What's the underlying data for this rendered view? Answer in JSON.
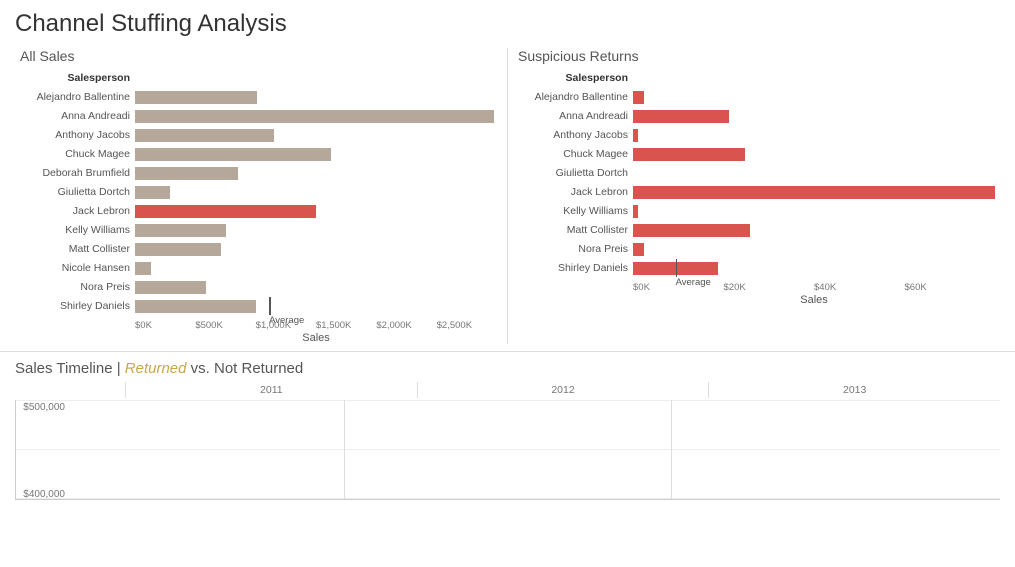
{
  "page": {
    "title": "Channel Stuffing Analysis"
  },
  "all_sales": {
    "title": "All Sales",
    "axis_label": "Sales",
    "header": "Salesperson",
    "avg_label": "Average",
    "x_ticks": [
      "$0K",
      "$500K",
      "$1,000K",
      "$1,500K",
      "$2,000K",
      "$2,500K"
    ],
    "max_value": 2700,
    "avg_value": 1000,
    "bars": [
      {
        "label": "Alejandro Ballentine",
        "value": 910,
        "type": "tan"
      },
      {
        "label": "Anna Andreadi",
        "value": 2680,
        "type": "tan"
      },
      {
        "label": "Anthony Jacobs",
        "value": 1040,
        "type": "tan"
      },
      {
        "label": "Chuck Magee",
        "value": 1460,
        "type": "tan"
      },
      {
        "label": "Deborah Brumfield",
        "value": 770,
        "type": "tan"
      },
      {
        "label": "Giulietta Dortch",
        "value": 260,
        "type": "tan"
      },
      {
        "label": "Jack Lebron",
        "value": 1350,
        "type": "red"
      },
      {
        "label": "Kelly Williams",
        "value": 680,
        "type": "tan"
      },
      {
        "label": "Matt Collister",
        "value": 640,
        "type": "tan"
      },
      {
        "label": "Nicole Hansen",
        "value": 120,
        "type": "tan"
      },
      {
        "label": "Nora Preis",
        "value": 530,
        "type": "tan"
      },
      {
        "label": "Shirley Daniels",
        "value": 900,
        "type": "tan"
      }
    ]
  },
  "suspicious_returns": {
    "title": "Suspicious Returns",
    "axis_label": "Sales",
    "header": "Salesperson",
    "avg_label": "Average",
    "x_ticks": [
      "$0K",
      "$20K",
      "$40K",
      "$60K"
    ],
    "max_value": 68,
    "avg_value": 8,
    "bars": [
      {
        "label": "Alejandro Ballentine",
        "value": 2,
        "type": "red"
      },
      {
        "label": "Anna Andreadi",
        "value": 18,
        "type": "red"
      },
      {
        "label": "Anthony Jacobs",
        "value": 1,
        "type": "red"
      },
      {
        "label": "Chuck Magee",
        "value": 21,
        "type": "red"
      },
      {
        "label": "Giulietta Dortch",
        "value": 0,
        "type": "red"
      },
      {
        "label": "Jack Lebron",
        "value": 68,
        "type": "red"
      },
      {
        "label": "Kelly Williams",
        "value": 1,
        "type": "red"
      },
      {
        "label": "Matt Collister",
        "value": 22,
        "type": "red"
      },
      {
        "label": "Nora Preis",
        "value": 2,
        "type": "red"
      },
      {
        "label": "Shirley Daniels",
        "value": 16,
        "type": "red"
      }
    ]
  },
  "timeline": {
    "title_prefix": "Sales Timeline | ",
    "returned_label": "Returned",
    "title_suffix": " vs. Not Returned",
    "years": [
      "2011",
      "2012",
      "2013"
    ],
    "y_labels": [
      "$500,000",
      "$400,000"
    ]
  }
}
